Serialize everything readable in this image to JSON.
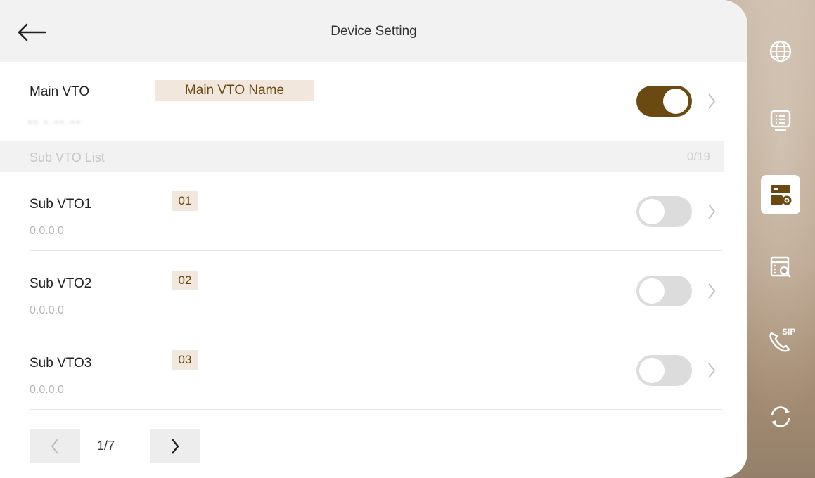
{
  "header": {
    "title": "Device Setting"
  },
  "main_vto": {
    "label": "Main VTO",
    "name": "Main VTO Name",
    "ip_blurred": "▪▪ ▪ ▪▪ ▪▪",
    "enabled": true
  },
  "sub_list": {
    "label": "Sub VTO List",
    "count": "0/19",
    "items": [
      {
        "label": "Sub VTO1",
        "number": "01",
        "ip": "0.0.0.0",
        "enabled": false
      },
      {
        "label": "Sub VTO2",
        "number": "02",
        "ip": "0.0.0.0",
        "enabled": false
      },
      {
        "label": "Sub VTO3",
        "number": "03",
        "ip": "0.0.0.0",
        "enabled": false
      }
    ]
  },
  "pager": {
    "text": "1/7"
  },
  "sidebar": {
    "icons": [
      {
        "name": "globe-icon",
        "active": false
      },
      {
        "name": "list-icon",
        "active": false
      },
      {
        "name": "device-settings-icon",
        "active": true
      },
      {
        "name": "device-search-icon",
        "active": false
      },
      {
        "name": "sip-phone-icon",
        "active": false,
        "text": "SIP"
      },
      {
        "name": "refresh-icon",
        "active": false
      }
    ]
  },
  "colors": {
    "accent": "#6b4a12",
    "badge_bg": "#f1e7dc",
    "toggle_off": "#dcdcdc",
    "header_bg": "#f2f2f2"
  }
}
